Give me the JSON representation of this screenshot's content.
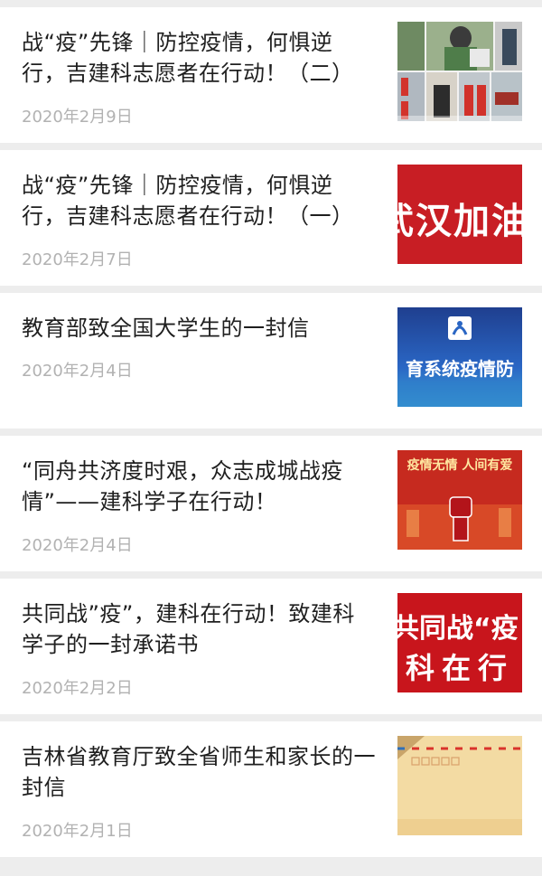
{
  "articles": [
    {
      "title": "战“疫”先锋｜防控疫情，何惧逆行，吉建科志愿者在行动！（二）",
      "date": "2020年2月9日",
      "thumb": "volunteers-photo-collage"
    },
    {
      "title": "战“疫”先锋｜防控疫情，何惧逆行，吉建科志愿者在行动！（一）",
      "date": "2020年2月7日",
      "thumb": "wuhan-jiayou-banner",
      "thumb_text": "武汉加油"
    },
    {
      "title": "教育部致全国大学生的一封信",
      "date": "2020年2月4日",
      "thumb": "education-system-banner",
      "thumb_text": "育系统疫情防"
    },
    {
      "title": "“同舟共济度时艰，众志成城战疫情”——建科学子在行动！",
      "date": "2020年2月4日",
      "thumb": "raised-fist-poster",
      "thumb_text": "疫情无情  人间有爱"
    },
    {
      "title": "共同战”疫”，建科在行动！致建科学子的一封承诺书",
      "date": "2020年2月2日",
      "thumb": "red-slogan-banner",
      "thumb_text_1": "共同战“疫",
      "thumb_text_2": "科在行"
    },
    {
      "title": "吉林省教育厅致全省师生和家长的一封信",
      "date": "2020年2月1日",
      "thumb": "envelope-postcard"
    }
  ]
}
